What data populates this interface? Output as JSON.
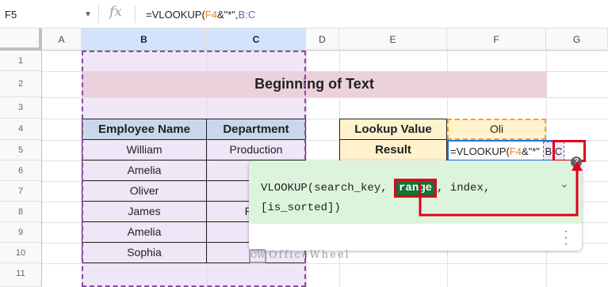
{
  "formula_bar": {
    "name_box": "F5",
    "fx_label": "fx",
    "formula_prefix": "=VLOOKUP(",
    "formula_ref1": "F4",
    "formula_mid": "&\"*\",",
    "formula_ref2": "B:C"
  },
  "columns": [
    "A",
    "B",
    "C",
    "D",
    "E",
    "F",
    "G"
  ],
  "rows": [
    "1",
    "2",
    "3",
    "4",
    "5",
    "6",
    "7",
    "8",
    "9",
    "10",
    "11"
  ],
  "banner": "Beginning of Text",
  "table": {
    "headers": [
      "Employee Name",
      "Department"
    ],
    "rows": [
      [
        "William",
        "Production"
      ],
      [
        "Amelia",
        ""
      ],
      [
        "Oliver",
        ""
      ],
      [
        "James",
        "Proc"
      ],
      [
        "Amelia",
        ""
      ],
      [
        "Sophia",
        ""
      ]
    ]
  },
  "lookup": {
    "label": "Lookup Value",
    "value": "Oli",
    "result_label": "Result",
    "edit_prefix": "=VLOOKUP(",
    "edit_ref1": "F4",
    "edit_mid": "&\"*\"",
    "edit_ref2": "B:C"
  },
  "popup": {
    "func": "VLOOKUP(search_key, ",
    "range": "range",
    "after_range": ", index,",
    "line2": "[is_sorted])"
  },
  "watermark": {
    "logo": "OW",
    "text": "OfficeWheel"
  },
  "colors": {
    "selection_fill": "#efe6f7",
    "selection_border": "#8e44ad",
    "header_fill": "#c9d7ea",
    "banner_fill": "#ead1dc",
    "lookup_fill": "#fff2cc",
    "popup_fill": "#dcf4dc",
    "range_highlight": "#137333",
    "annotation_red": "#e0001b"
  }
}
